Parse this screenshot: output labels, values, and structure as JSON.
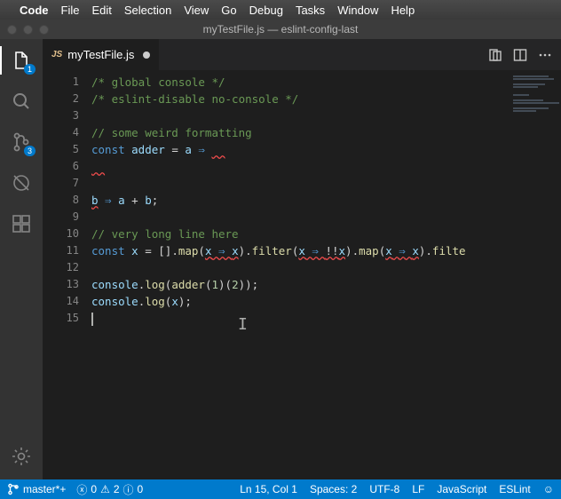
{
  "menubar": {
    "items": [
      "Code",
      "File",
      "Edit",
      "Selection",
      "View",
      "Go",
      "Debug",
      "Tasks",
      "Window",
      "Help"
    ]
  },
  "window": {
    "title": "myTestFile.js — eslint-config-last"
  },
  "activitybar": {
    "explorer_badge": "1",
    "scm_badge": "3"
  },
  "tab": {
    "lang_abbr": "JS",
    "filename": "myTestFile.js"
  },
  "editor": {
    "line_numbers": [
      "1",
      "2",
      "3",
      "4",
      "5",
      "6",
      "7",
      "8",
      "9",
      "10",
      "11",
      "12",
      "13",
      "14",
      "15"
    ],
    "lines": {
      "l1": "/* global console */",
      "l2": "/* eslint-disable no-console */",
      "l4": "// some weird formatting",
      "l5_const": "const ",
      "l5_adder": "adder",
      "l5_eq": " = ",
      "l5_a": "a",
      "l5_arrow": " ⇒ ",
      "l6_err": "  ",
      "l8_b": "b",
      "l8_arrow": " ⇒ ",
      "l8_a": "a",
      "l8_plus": " + ",
      "l8_b2": "b",
      "l8_semi": ";",
      "l10": "// very long line here",
      "l11_const": "const ",
      "l11_x": "x",
      "l11_eq": " = [].",
      "l11_map": "map",
      "l11_p1": "(",
      "l11_xv": "x",
      "l11_ar": " ⇒ ",
      "l11_xv2": "x",
      "l11_p2": ").",
      "l11_filter": "filter",
      "l11_p3": "(",
      "l11_xv3": "x",
      "l11_ar2": " ⇒ ",
      "l11_bang": "!!",
      "l11_xv4": "x",
      "l11_p4": ").",
      "l11_map2": "map",
      "l11_p5": "(",
      "l11_xv5": "x",
      "l11_ar3": " ⇒ ",
      "l11_xv6": "x",
      "l11_p6": ").",
      "l11_filte": "filte",
      "l13_console": "console",
      "l13_dot": ".",
      "l13_log": "log",
      "l13_open": "(",
      "l13_adder": "adder",
      "l13_args": "(",
      "l13_n1": "1",
      "l13_mid": ")(",
      "l13_n2": "2",
      "l13_close": "));",
      "l14_console": "console",
      "l14_dot": ".",
      "l14_log": "log",
      "l14_open": "(",
      "l14_x": "x",
      "l14_close": ");"
    }
  },
  "status": {
    "branch": "master*+",
    "errors": "0",
    "warnings": "2",
    "info": "0",
    "position": "Ln 15, Col 1",
    "spaces": "Spaces: 2",
    "encoding": "UTF-8",
    "eol": "LF",
    "language": "JavaScript",
    "linter": "ESLint"
  }
}
